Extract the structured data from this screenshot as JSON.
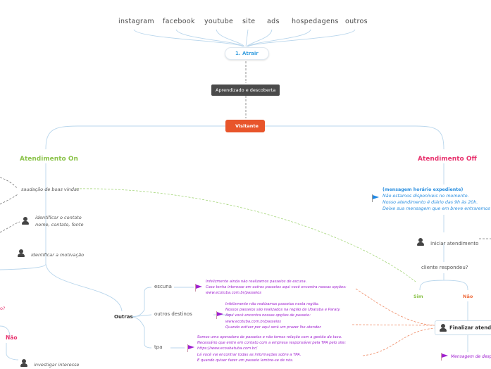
{
  "sources": [
    "instagram",
    "facebook",
    "youtube",
    "site",
    "ads",
    "hospedagens",
    "outros"
  ],
  "attract": {
    "label": "1. Atrair"
  },
  "learning": {
    "label": "Aprendizado e descoberta"
  },
  "visitor": {
    "label": "Visitante"
  },
  "on": {
    "title": "Atendimento On",
    "greeting": "saudação de boas vindas",
    "identify_contact": "identificar o contato",
    "identify_contact_fields": "nome, contato, fonte",
    "identify_motivation": "identificar a motivação",
    "partial_question": "o?",
    "no_label": "Não",
    "investigate": "investigar interesse"
  },
  "others": {
    "label": "Outras",
    "branches": [
      {
        "label": "escuna",
        "message": "Infelizmente ainda não realizamos passeios de escuna.\nCaso tenha interesse em outros passeios aqui você encontra nossas opções:\nwww.ecotuba.com.br/passeios"
      },
      {
        "label": "outros destinos",
        "message": "Infelizmente não realizamos passeios nesta região.\nNossos passeios são realizados na região de Ubatuba e Paraty.\nAqui você encontra nossas opções de passeio:\nwww.ecotuba.com.br/passeios\nQuando estiver por aqui será um prazer lhe atender."
      },
      {
        "label": "tpa",
        "message": "Somos uma operadora de passeios e não temos relação com a gestão da taxa.\nNecessário que entre em contato com a empresa responsável pela TPA pelo site:\nhttps://www.ecoubatuba.com.br/\nLá você vai encontrar todas as informações sobre a TPA.\nE quando quiser fazer um passeio lembre-se de nós."
      }
    ]
  },
  "off": {
    "title": "Atendimento Off",
    "message_title": "(mensagem horário expediente)",
    "message_lines": "Não estamos disponíveis no momento.\nNosso atendimento é diário das 9h às 20h.\nDeixe sua mensagem que em breve entraremos e",
    "start": "iniciar atendimento",
    "question": "cliente respondeu?",
    "yes": "Sim",
    "no": "Não",
    "finish": "Finalizar atendime",
    "farewell": "Mensagem de despe"
  },
  "colors": {
    "orange": "#e8552b",
    "green": "#8bc34a",
    "pink": "#e8336e",
    "purple": "#a020d0",
    "blue": "#2a8fe0"
  }
}
